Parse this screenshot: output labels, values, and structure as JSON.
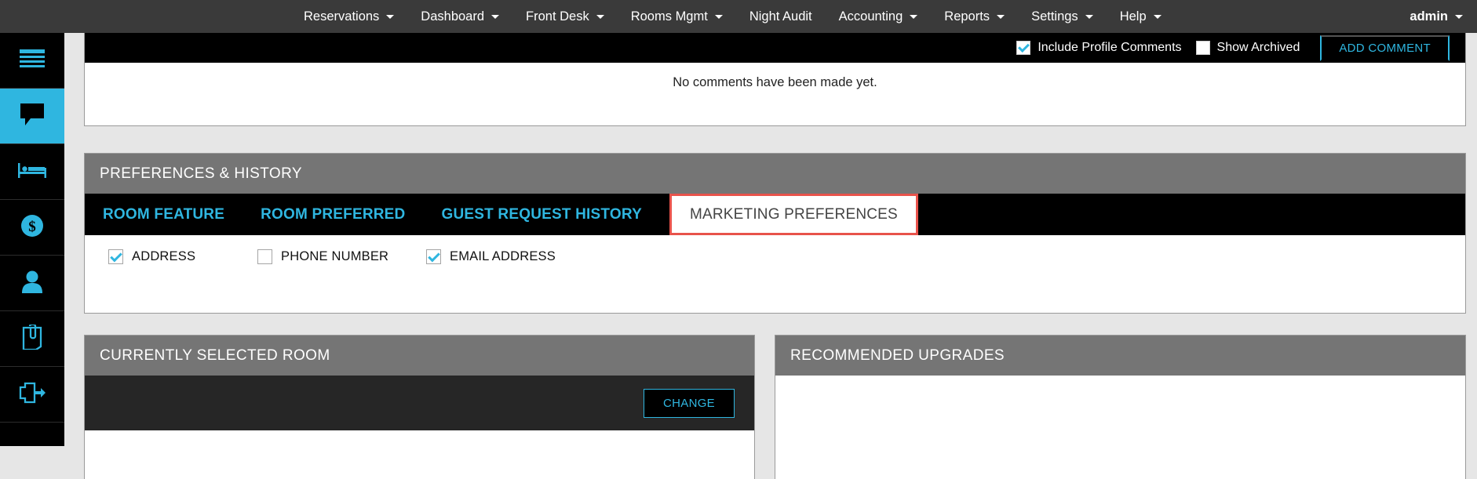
{
  "topnav": {
    "items": [
      {
        "label": "Reservations",
        "has_caret": true
      },
      {
        "label": "Dashboard",
        "has_caret": true
      },
      {
        "label": "Front Desk",
        "has_caret": true
      },
      {
        "label": "Rooms Mgmt",
        "has_caret": true
      },
      {
        "label": "Night Audit",
        "has_caret": false
      },
      {
        "label": "Accounting",
        "has_caret": true
      },
      {
        "label": "Reports",
        "has_caret": true
      },
      {
        "label": "Settings",
        "has_caret": true
      },
      {
        "label": "Help",
        "has_caret": true
      }
    ],
    "user": "admin"
  },
  "sidebar": {
    "items": [
      {
        "name": "menu-icon",
        "active": false
      },
      {
        "name": "comment-icon",
        "active": true
      },
      {
        "name": "bed-icon",
        "active": false
      },
      {
        "name": "dollar-icon",
        "active": false
      },
      {
        "name": "person-icon",
        "active": false
      },
      {
        "name": "attachment-icon",
        "active": false
      },
      {
        "name": "checkout-icon",
        "active": false
      }
    ]
  },
  "comments": {
    "include_profile_comments": {
      "label": "Include Profile Comments",
      "checked": true
    },
    "show_archived": {
      "label": "Show Archived",
      "checked": false
    },
    "add_comment_label": "ADD COMMENT",
    "empty_message": "No comments have been made yet."
  },
  "preferences": {
    "title": "PREFERENCES & HISTORY",
    "tabs": [
      {
        "label": "ROOM FEATURE",
        "active": false
      },
      {
        "label": "ROOM PREFERRED",
        "active": false
      },
      {
        "label": "GUEST REQUEST HISTORY",
        "active": false
      },
      {
        "label": "MARKETING PREFERENCES",
        "active": true
      }
    ],
    "marketing_checks": [
      {
        "label": "ADDRESS",
        "checked": true
      },
      {
        "label": "PHONE NUMBER",
        "checked": false
      },
      {
        "label": "EMAIL ADDRESS",
        "checked": true
      }
    ]
  },
  "currently_selected_room": {
    "title": "CURRENTLY SELECTED ROOM",
    "change_label": "CHANGE"
  },
  "recommended_upgrades": {
    "title": "RECOMMENDED UPGRADES"
  },
  "colors": {
    "accent_cyan": "#2fb6e0",
    "active_tab_outline": "#e8534b",
    "panel_header_gray": "#757575",
    "topnav_gray": "#3a3a3a"
  }
}
